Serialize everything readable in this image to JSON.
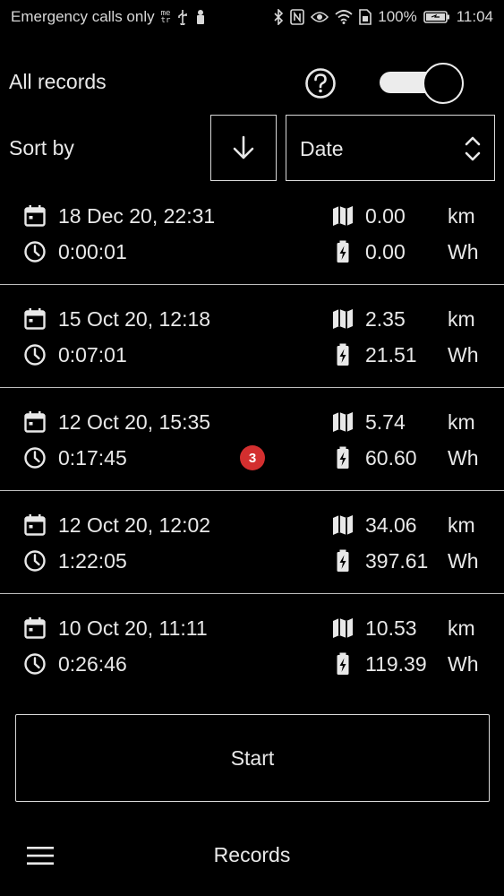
{
  "status_bar": {
    "carrier_text": "Emergency calls only",
    "meter_glyph": "me\ntr",
    "battery_percent": "100%",
    "time": "11:04",
    "icons": [
      "usb-icon",
      "notification-icon",
      "bluetooth-icon",
      "nfc-icon",
      "eye-icon",
      "wifi-icon",
      "sim-icon",
      "battery-icon"
    ]
  },
  "header": {
    "all_records_label": "All records",
    "help_icon": "question-circle-icon",
    "toggle_on": true
  },
  "sort": {
    "label": "Sort by",
    "direction_icon": "arrow-down-icon",
    "selected_value": "Date",
    "chevron_icon": "up-down-chevron-icon"
  },
  "records": [
    {
      "date": "18 Dec 20, 22:31",
      "duration": "0:00:01",
      "distance": "0.00",
      "distance_unit": "km",
      "energy": "0.00",
      "energy_unit": "Wh",
      "badge": ""
    },
    {
      "date": "15 Oct 20, 12:18",
      "duration": "0:07:01",
      "distance": "2.35",
      "distance_unit": "km",
      "energy": "21.51",
      "energy_unit": "Wh",
      "badge": ""
    },
    {
      "date": "12 Oct 20, 15:35",
      "duration": "0:17:45",
      "distance": "5.74",
      "distance_unit": "km",
      "energy": "60.60",
      "energy_unit": "Wh",
      "badge": "3"
    },
    {
      "date": "12 Oct 20, 12:02",
      "duration": "1:22:05",
      "distance": "34.06",
      "distance_unit": "km",
      "energy": "397.61",
      "energy_unit": "Wh",
      "badge": ""
    },
    {
      "date": "10 Oct 20, 11:11",
      "duration": "0:26:46",
      "distance": "10.53",
      "distance_unit": "km",
      "energy": "119.39",
      "energy_unit": "Wh",
      "badge": ""
    }
  ],
  "start_button_label": "Start",
  "bottom_bar": {
    "menu_icon": "hamburger-menu-icon",
    "title": "Records"
  },
  "colors": {
    "background": "#000000",
    "foreground": "#e8e8e8",
    "badge": "#d32f2f"
  }
}
